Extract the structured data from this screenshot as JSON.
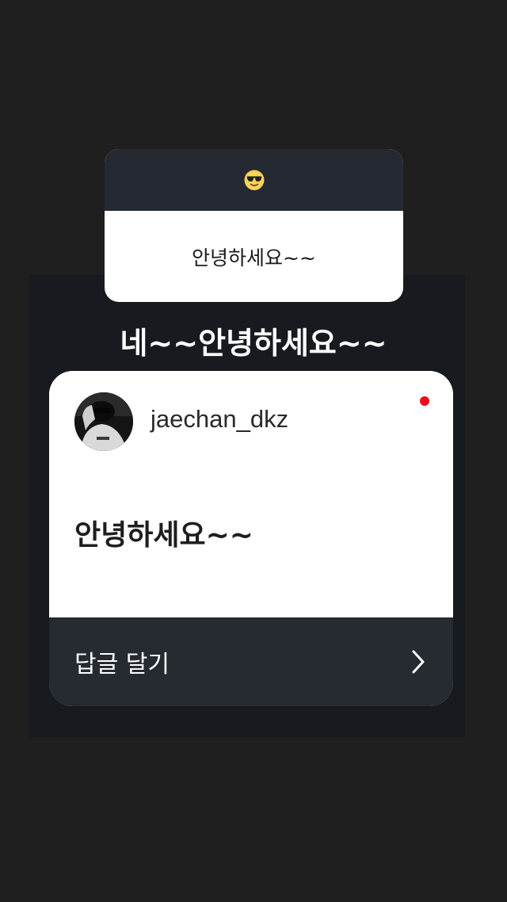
{
  "question_sticker": {
    "emoji": "sunglasses-face-icon",
    "question": "안녕하세요~~"
  },
  "answer_title": "네~~안녕하세요~~",
  "reply_card": {
    "username": "jaechan_dkz",
    "message": "안녕하세요~~",
    "action_label": "답글 달기",
    "unread_dot_color": "#e8101a",
    "action_icon": "chevron-right-icon"
  },
  "colors": {
    "background": "#1f1f1f",
    "panel": "#171b20",
    "sticker_header": "#252a32",
    "card_footer": "#262a31"
  }
}
